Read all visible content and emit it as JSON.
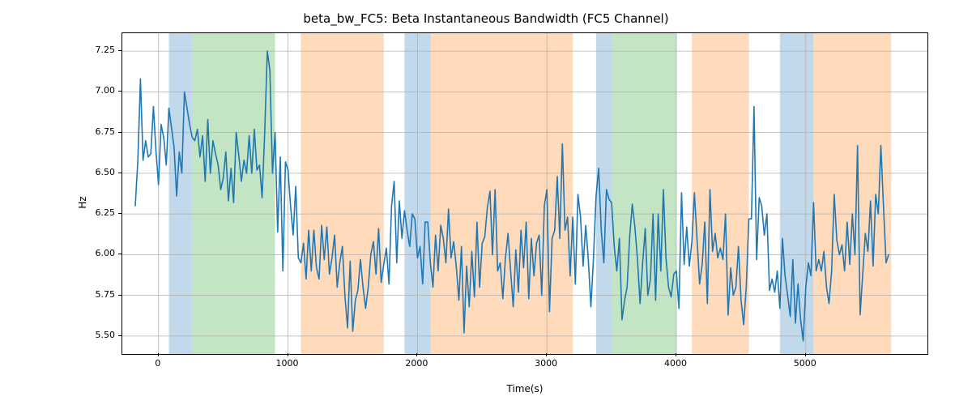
{
  "chart_data": {
    "type": "line",
    "title": "beta_bw_FC5: Beta Instantaneous Bandwidth (FC5 Channel)",
    "xlabel": "Time(s)",
    "ylabel": "Hz",
    "xlim": [
      -280,
      5940
    ],
    "ylim": [
      5.39,
      7.36
    ],
    "xticks": [
      0,
      1000,
      2000,
      3000,
      4000,
      5000
    ],
    "yticks": [
      5.5,
      5.75,
      6.0,
      6.25,
      6.5,
      6.75,
      7.0,
      7.25
    ],
    "bands": [
      {
        "start": 80,
        "end": 260,
        "color": "blue"
      },
      {
        "start": 260,
        "end": 900,
        "color": "green"
      },
      {
        "start": 1100,
        "end": 1740,
        "color": "orange"
      },
      {
        "start": 1900,
        "end": 2100,
        "color": "blue"
      },
      {
        "start": 2100,
        "end": 2540,
        "color": "orange"
      },
      {
        "start": 2540,
        "end": 3200,
        "color": "orange"
      },
      {
        "start": 3380,
        "end": 3500,
        "color": "blue"
      },
      {
        "start": 3500,
        "end": 4000,
        "color": "green"
      },
      {
        "start": 4120,
        "end": 4560,
        "color": "orange"
      },
      {
        "start": 4800,
        "end": 5060,
        "color": "blue"
      },
      {
        "start": 5060,
        "end": 5380,
        "color": "orange"
      },
      {
        "start": 5380,
        "end": 5660,
        "color": "orange"
      }
    ],
    "x": [
      -180,
      -160,
      -140,
      -120,
      -100,
      -80,
      -60,
      -40,
      -20,
      0,
      20,
      40,
      60,
      80,
      100,
      120,
      140,
      160,
      180,
      200,
      220,
      240,
      260,
      280,
      300,
      320,
      340,
      360,
      380,
      400,
      420,
      440,
      460,
      480,
      500,
      520,
      540,
      560,
      580,
      600,
      620,
      640,
      660,
      680,
      700,
      720,
      740,
      760,
      780,
      800,
      820,
      840,
      860,
      880,
      900,
      920,
      940,
      960,
      980,
      1000,
      1020,
      1040,
      1060,
      1080,
      1100,
      1120,
      1140,
      1160,
      1180,
      1200,
      1220,
      1240,
      1260,
      1280,
      1300,
      1320,
      1340,
      1360,
      1380,
      1400,
      1420,
      1440,
      1460,
      1480,
      1500,
      1520,
      1540,
      1560,
      1580,
      1600,
      1620,
      1640,
      1660,
      1680,
      1700,
      1720,
      1740,
      1760,
      1780,
      1800,
      1820,
      1840,
      1860,
      1880,
      1900,
      1920,
      1940,
      1960,
      1980,
      2000,
      2020,
      2040,
      2060,
      2080,
      2100,
      2120,
      2140,
      2160,
      2180,
      2200,
      2220,
      2240,
      2260,
      2280,
      2300,
      2320,
      2340,
      2360,
      2380,
      2400,
      2420,
      2440,
      2460,
      2480,
      2500,
      2520,
      2540,
      2560,
      2580,
      2600,
      2620,
      2640,
      2660,
      2680,
      2700,
      2720,
      2740,
      2760,
      2780,
      2800,
      2820,
      2840,
      2860,
      2880,
      2900,
      2920,
      2940,
      2960,
      2980,
      3000,
      3020,
      3040,
      3060,
      3080,
      3100,
      3120,
      3140,
      3160,
      3180,
      3200,
      3220,
      3240,
      3260,
      3280,
      3300,
      3320,
      3340,
      3360,
      3380,
      3400,
      3420,
      3440,
      3460,
      3480,
      3500,
      3520,
      3540,
      3560,
      3580,
      3600,
      3620,
      3640,
      3660,
      3680,
      3700,
      3720,
      3740,
      3760,
      3780,
      3800,
      3820,
      3840,
      3860,
      3880,
      3900,
      3920,
      3940,
      3960,
      3980,
      4000,
      4020,
      4040,
      4060,
      4080,
      4100,
      4120,
      4140,
      4160,
      4180,
      4200,
      4220,
      4240,
      4260,
      4280,
      4300,
      4320,
      4340,
      4360,
      4380,
      4400,
      4420,
      4440,
      4460,
      4480,
      4500,
      4520,
      4540,
      4560,
      4580,
      4600,
      4620,
      4640,
      4660,
      4680,
      4700,
      4720,
      4740,
      4760,
      4780,
      4800,
      4820,
      4840,
      4860,
      4880,
      4900,
      4920,
      4940,
      4960,
      4980,
      5000,
      5020,
      5040,
      5060,
      5080,
      5100,
      5120,
      5140,
      5160,
      5180,
      5200,
      5220,
      5240,
      5260,
      5280,
      5300,
      5320,
      5340,
      5360,
      5380,
      5400,
      5420,
      5440,
      5460,
      5480,
      5500,
      5520,
      5540,
      5560,
      5580,
      5600,
      5620,
      5640
    ],
    "y": [
      6.3,
      6.58,
      7.08,
      6.58,
      6.7,
      6.6,
      6.62,
      6.91,
      6.64,
      6.43,
      6.8,
      6.72,
      6.55,
      6.9,
      6.78,
      6.66,
      6.36,
      6.63,
      6.5,
      7.0,
      6.9,
      6.8,
      6.72,
      6.7,
      6.77,
      6.6,
      6.73,
      6.45,
      6.83,
      6.5,
      6.7,
      6.62,
      6.55,
      6.4,
      6.47,
      6.63,
      6.33,
      6.53,
      6.32,
      6.75,
      6.61,
      6.45,
      6.58,
      6.5,
      6.73,
      6.5,
      6.77,
      6.52,
      6.55,
      6.35,
      6.75,
      7.25,
      7.13,
      6.5,
      6.75,
      6.14,
      6.6,
      5.9,
      6.57,
      6.52,
      6.3,
      6.12,
      6.42,
      5.98,
      5.95,
      6.07,
      5.85,
      6.15,
      5.9,
      6.15,
      5.92,
      5.85,
      6.18,
      5.97,
      6.17,
      5.88,
      5.98,
      6.12,
      5.8,
      5.95,
      6.05,
      5.74,
      5.55,
      5.96,
      5.53,
      5.72,
      5.78,
      5.97,
      5.8,
      5.67,
      5.8,
      6.0,
      6.08,
      5.88,
      6.16,
      5.83,
      5.94,
      6.04,
      5.82,
      6.3,
      6.45,
      5.95,
      6.33,
      6.1,
      6.27,
      6.15,
      6.05,
      6.25,
      6.22,
      5.98,
      6.05,
      5.82,
      6.2,
      6.2,
      5.95,
      5.8,
      6.12,
      5.9,
      6.18,
      6.1,
      5.95,
      6.28,
      5.98,
      6.08,
      5.93,
      5.72,
      6.05,
      5.52,
      5.93,
      5.68,
      6.02,
      5.74,
      6.2,
      5.8,
      6.07,
      6.11,
      6.29,
      6.39,
      6.0,
      6.4,
      5.9,
      5.95,
      5.73,
      5.98,
      6.13,
      5.9,
      5.68,
      6.03,
      5.77,
      6.15,
      5.92,
      6.2,
      5.73,
      6.1,
      5.87,
      6.07,
      6.12,
      5.75,
      6.3,
      6.4,
      5.65,
      6.1,
      6.15,
      6.48,
      6.1,
      6.68,
      6.15,
      6.23,
      5.87,
      6.23,
      5.82,
      6.37,
      6.23,
      5.93,
      6.18,
      5.97,
      5.68,
      5.98,
      6.36,
      6.53,
      6.15,
      5.95,
      6.4,
      6.34,
      6.32,
      6.05,
      5.9,
      6.1,
      5.6,
      5.72,
      5.8,
      6.11,
      6.31,
      6.17,
      5.97,
      5.7,
      5.95,
      6.16,
      5.75,
      5.85,
      6.25,
      5.72,
      6.25,
      5.9,
      6.4,
      5.98,
      5.8,
      5.74,
      5.88,
      5.9,
      5.67,
      6.38,
      5.94,
      6.17,
      5.93,
      6.08,
      6.38,
      6.1,
      5.82,
      5.94,
      6.2,
      5.7,
      6.4,
      6.02,
      6.13,
      5.98,
      6.04,
      5.97,
      6.25,
      5.63,
      5.92,
      5.75,
      5.8,
      6.05,
      5.72,
      5.57,
      5.8,
      6.22,
      6.22,
      6.91,
      5.97,
      6.35,
      6.3,
      6.12,
      6.25,
      5.78,
      5.85,
      5.77,
      5.9,
      5.67,
      6.1,
      5.87,
      5.75,
      5.62,
      5.97,
      5.58,
      5.82,
      5.6,
      5.47,
      5.8,
      5.95,
      5.87,
      6.32,
      5.9,
      5.97,
      5.9,
      6.02,
      5.8,
      5.7,
      5.9,
      6.37,
      6.09,
      6.0,
      6.06,
      5.9,
      6.2,
      5.94,
      6.25,
      6.0,
      6.67,
      5.63,
      5.88,
      6.13,
      6.02,
      6.33,
      5.93,
      6.37,
      6.25,
      6.67,
      6.3,
      5.95,
      6.0
    ]
  }
}
